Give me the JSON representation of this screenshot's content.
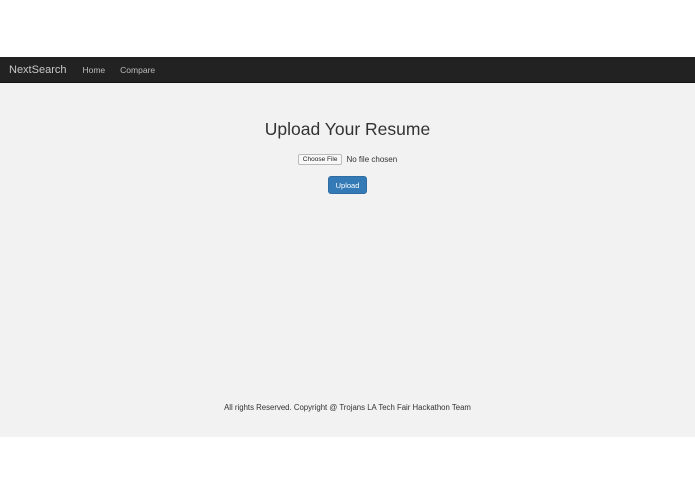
{
  "navbar": {
    "brand": "NextSearch",
    "links": [
      {
        "label": "Home"
      },
      {
        "label": "Compare"
      }
    ]
  },
  "main": {
    "title": "Upload Your Resume",
    "file_input": {
      "button_label": "Choose File",
      "status": "No file chosen"
    },
    "upload_label": "Upload"
  },
  "footer": {
    "text": "All rights Reserved. Copyright @ Trojans LA Tech Fair Hackathon Team"
  },
  "colors": {
    "navbar_bg": "#222222",
    "content_bg": "#f2f2f2",
    "primary_button": "#337ab7"
  }
}
